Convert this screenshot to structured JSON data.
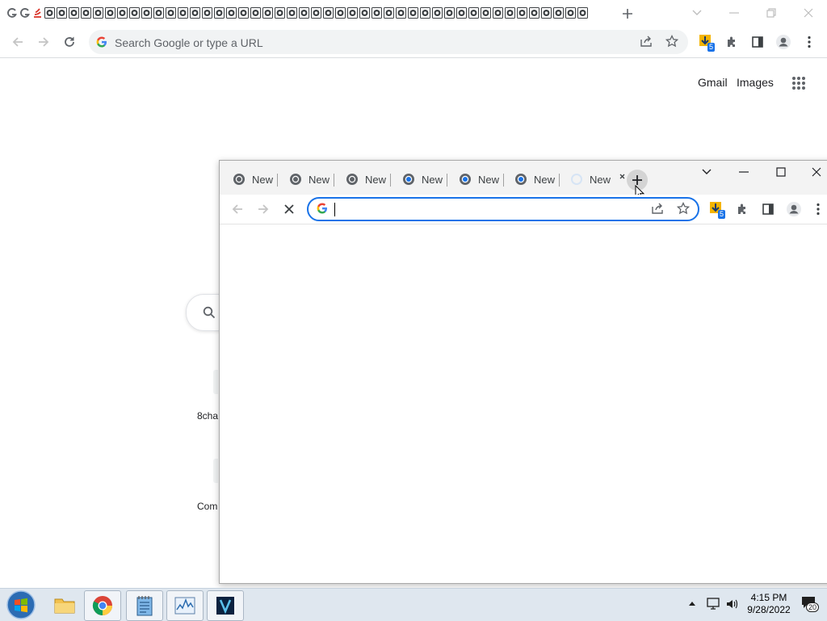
{
  "back_window": {
    "omnibox_placeholder": "Search Google or type a URL",
    "links": {
      "gmail": "Gmail",
      "images": "Images"
    },
    "partial_labels": {
      "shortcut_1": "8cha",
      "shortcut_2": "Com"
    },
    "extension_badge": "5"
  },
  "front_window": {
    "tabs": [
      {
        "label": "New"
      },
      {
        "label": "New"
      },
      {
        "label": "New"
      },
      {
        "label": "New"
      },
      {
        "label": "New"
      },
      {
        "label": "New"
      },
      {
        "label": "New"
      }
    ],
    "extension_badge": "5"
  },
  "taskbar": {
    "time": "4:15 PM",
    "date": "9/28/2022",
    "notification_count": "20"
  },
  "colors": {
    "accent": "#1a73e8",
    "taskbar_bg": "#dfe7ef",
    "extension_badge_bg": "#1a73e8"
  },
  "icons": {
    "back_tabs": "chrome-icon-repeat",
    "new_tab": "plus-icon",
    "reload": "reload-icon",
    "stop": "stop-icon",
    "apps": "apps-grid-icon"
  }
}
